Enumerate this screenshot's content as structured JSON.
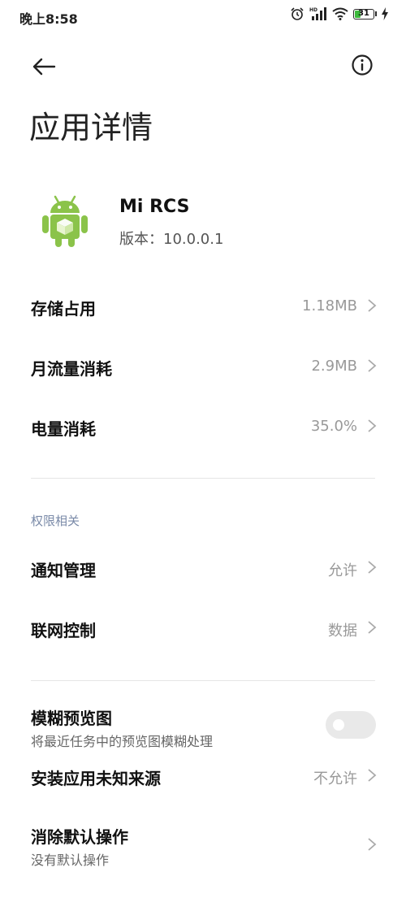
{
  "status_bar": {
    "time": "晚上8:58",
    "battery": "31",
    "battery_level": 0.31,
    "icons": [
      "alarm-icon",
      "hd-signal-icon",
      "wifi-icon",
      "battery-icon",
      "charging-icon"
    ]
  },
  "header": {
    "back_icon": "arrow-left-icon",
    "info_icon": "info-icon",
    "title": "应用详情"
  },
  "app": {
    "icon": "android-robot-icon",
    "name": "Mi RCS",
    "version": "版本：10.0.0.1"
  },
  "usage_rows": [
    {
      "label": "存储占用",
      "value": "1.18MB"
    },
    {
      "label": "月流量消耗",
      "value": "2.9MB"
    },
    {
      "label": "电量消耗",
      "value": "35.0%"
    }
  ],
  "permissions": {
    "section_title": "权限相关",
    "rows": [
      {
        "label": "通知管理",
        "value": "允许"
      },
      {
        "label": "联网控制",
        "value": "数据"
      }
    ]
  },
  "other": {
    "blur_preview": {
      "label": "模糊预览图",
      "sublabel": "将最近任务中的预览图模糊处理",
      "enabled": false
    },
    "unknown_sources": {
      "label": "安装应用未知来源",
      "value": "不允许"
    },
    "clear_defaults": {
      "label": "消除默认操作",
      "sublabel": "没有默认操作"
    }
  },
  "colors": {
    "accent_green": "#3dbb3d",
    "android_green": "#8bc34a",
    "section_header": "#7a8aa8",
    "value_gray": "#999999"
  }
}
